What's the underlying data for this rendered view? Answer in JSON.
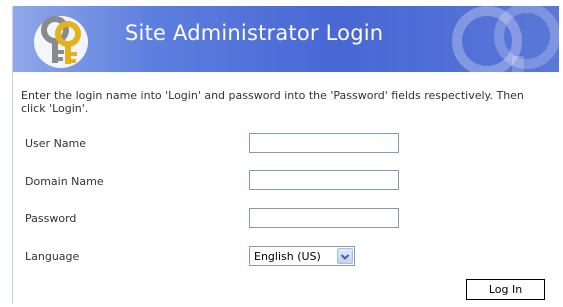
{
  "header": {
    "title": "Site Administrator Login",
    "logo_icon": "keys-icon",
    "watermark_icon": "keys-watermark-icon",
    "background_color": "#4867d4"
  },
  "instructions": "Enter the login name into 'Login' and password into the 'Password' fields respectively. Then click 'Login'.",
  "form": {
    "user_name": {
      "label": "User Name",
      "value": ""
    },
    "domain_name": {
      "label": "Domain Name",
      "value": ""
    },
    "password": {
      "label": "Password",
      "value": ""
    },
    "language": {
      "label": "Language",
      "selected": "English (US)",
      "arrow_icon": "chevron-down-icon"
    }
  },
  "buttons": {
    "login_label": "Log In"
  }
}
